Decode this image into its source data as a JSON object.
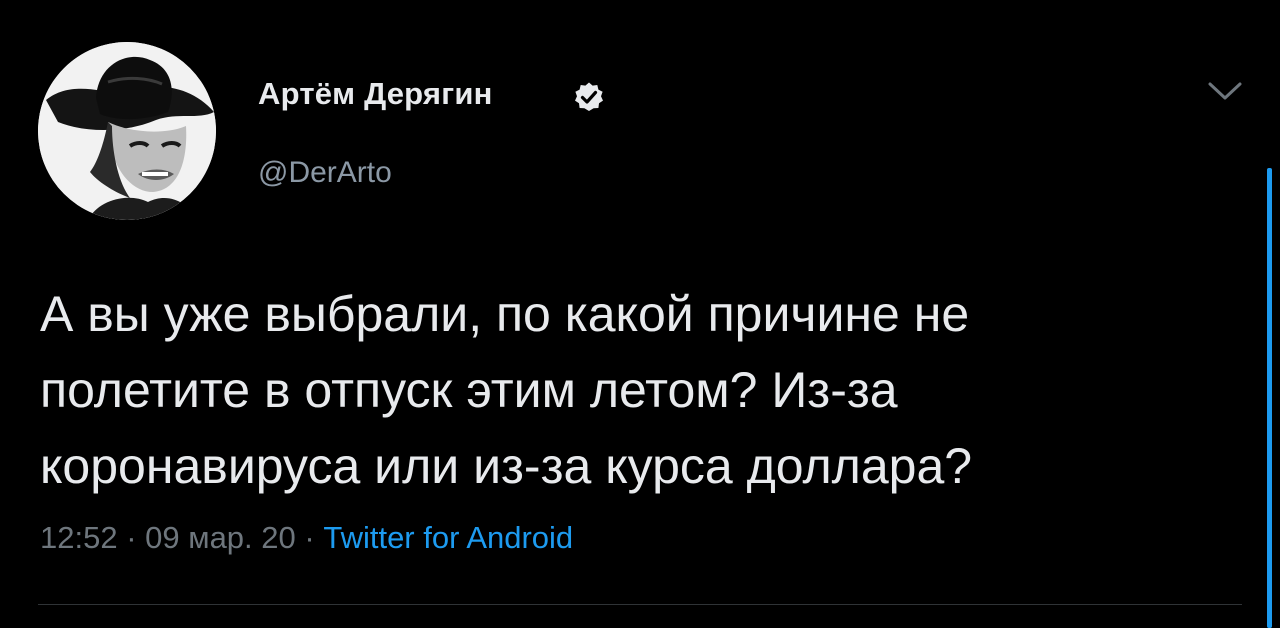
{
  "author": {
    "display_name": "Артём Дерягин",
    "handle": "@DerArto",
    "verified": true,
    "avatar_icon": "avatar-cowboy-hat-portrait"
  },
  "tweet": {
    "lines": [
      "А вы уже выбрали, по какой причине не",
      "полетите в отпуск этим летом? Из-за",
      "коронавируса или из-за курса доллара?"
    ]
  },
  "meta": {
    "time": "12:52",
    "separator": "·",
    "date": "09 мар. 20",
    "source": "Twitter for Android"
  },
  "icons": {
    "verified": "verified-badge-icon",
    "menu": "chevron-down-icon"
  },
  "colors": {
    "background": "#000000",
    "text": "#e8eaed",
    "secondary": "#6e767d",
    "accent": "#1d9bf0"
  }
}
